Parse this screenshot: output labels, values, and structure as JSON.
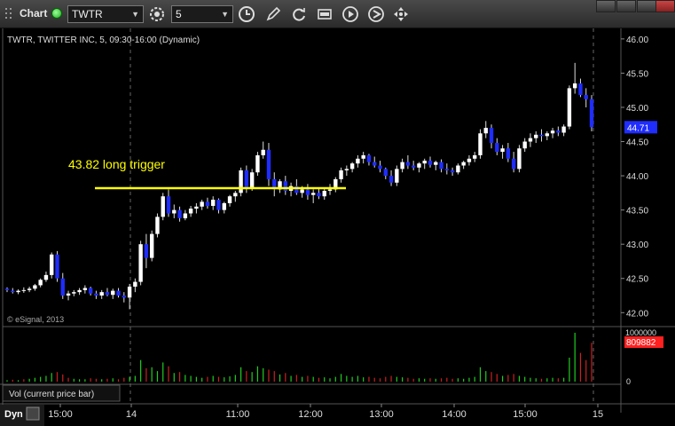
{
  "toolbar": {
    "title": "Chart",
    "symbol": "TWTR",
    "interval": "5",
    "icons": [
      "grip-icon",
      "link-status-icon",
      "settings-gear-icon",
      "clock-icon",
      "pencil-draw-icon",
      "refresh-icon",
      "goto-date-icon",
      "replay-icon",
      "pan-icon"
    ]
  },
  "chart": {
    "header": "TWTR, TWITTER INC, 5, 09:30-16:00 (Dynamic)",
    "copyright": "© eSignal, 2013",
    "annotation": "43.82 long trigger",
    "current_price": "44.71",
    "volume_label": "Vol (current price bar)",
    "volume_current": "809882",
    "volume_top_tick": "1000000",
    "volume_zero_tick": "0",
    "dyn_label": "Dyn",
    "colors": {
      "up": "#ffffff",
      "down": "#1f2dff",
      "annotation": "#ffff00",
      "price_tag": "#1f2dff",
      "volume_tag": "#ff2020",
      "vol_up": "#22cc22",
      "vol_down": "#cc2020"
    }
  },
  "chart_data": {
    "type": "candlestick",
    "y_axis": {
      "ticks": [
        "46.00",
        "45.50",
        "45.00",
        "44.50",
        "44.00",
        "43.50",
        "43.00",
        "42.50",
        "42.00"
      ],
      "range": [
        41.9,
        46.05
      ]
    },
    "x_axis": {
      "ticks": [
        "15:00",
        "14",
        "11:00",
        "12:00",
        "13:00",
        "14:00",
        "15:00",
        "15"
      ]
    },
    "trigger_level": 43.82,
    "candles": [
      [
        42.35,
        42.37,
        42.3,
        42.33
      ],
      [
        42.32,
        42.36,
        42.28,
        42.3
      ],
      [
        42.3,
        42.34,
        42.27,
        42.32
      ],
      [
        42.32,
        42.37,
        42.29,
        42.33
      ],
      [
        42.33,
        42.38,
        42.3,
        42.35
      ],
      [
        42.35,
        42.42,
        42.32,
        42.4
      ],
      [
        42.4,
        42.5,
        42.37,
        42.48
      ],
      [
        42.48,
        42.6,
        42.45,
        42.55
      ],
      [
        42.55,
        42.88,
        42.5,
        42.85
      ],
      [
        42.85,
        42.9,
        42.45,
        42.5
      ],
      [
        42.5,
        42.58,
        42.2,
        42.25
      ],
      [
        42.25,
        42.32,
        42.18,
        42.28
      ],
      [
        42.28,
        42.33,
        42.24,
        42.3
      ],
      [
        42.3,
        42.36,
        42.26,
        42.33
      ],
      [
        42.33,
        42.4,
        42.28,
        42.36
      ],
      [
        42.36,
        42.38,
        42.25,
        42.28
      ],
      [
        42.28,
        42.32,
        42.2,
        42.25
      ],
      [
        42.25,
        42.33,
        42.2,
        42.3
      ],
      [
        42.3,
        42.36,
        42.24,
        42.26
      ],
      [
        42.26,
        42.35,
        42.2,
        42.32
      ],
      [
        42.32,
        42.36,
        42.22,
        42.25
      ],
      [
        42.25,
        42.3,
        42.15,
        42.22
      ],
      [
        42.22,
        42.42,
        42.05,
        42.38
      ],
      [
        42.38,
        42.5,
        42.3,
        42.45
      ],
      [
        42.45,
        43.05,
        42.4,
        43.0
      ],
      [
        43.0,
        43.15,
        42.65,
        42.8
      ],
      [
        42.8,
        43.2,
        42.75,
        43.15
      ],
      [
        43.15,
        43.45,
        43.1,
        43.4
      ],
      [
        43.4,
        43.75,
        43.35,
        43.7
      ],
      [
        43.7,
        43.8,
        43.4,
        43.45
      ],
      [
        43.45,
        43.58,
        43.38,
        43.5
      ],
      [
        43.5,
        43.55,
        43.33,
        43.38
      ],
      [
        43.38,
        43.5,
        43.35,
        43.45
      ],
      [
        43.45,
        43.56,
        43.4,
        43.52
      ],
      [
        43.52,
        43.6,
        43.45,
        43.55
      ],
      [
        43.55,
        43.65,
        43.5,
        43.62
      ],
      [
        43.62,
        43.68,
        43.52,
        43.56
      ],
      [
        43.56,
        43.7,
        43.5,
        43.65
      ],
      [
        43.65,
        43.67,
        43.45,
        43.5
      ],
      [
        43.5,
        43.62,
        43.45,
        43.6
      ],
      [
        43.6,
        43.72,
        43.55,
        43.7
      ],
      [
        43.7,
        43.78,
        43.62,
        43.75
      ],
      [
        43.75,
        44.12,
        43.7,
        44.08
      ],
      [
        44.08,
        44.15,
        43.75,
        43.82
      ],
      [
        43.82,
        44.1,
        43.78,
        44.05
      ],
      [
        44.05,
        44.35,
        44.0,
        44.3
      ],
      [
        44.3,
        44.5,
        44.25,
        44.38
      ],
      [
        44.38,
        44.48,
        43.85,
        43.95
      ],
      [
        43.95,
        44.05,
        43.7,
        43.8
      ],
      [
        43.8,
        43.95,
        43.75,
        43.92
      ],
      [
        43.92,
        44.0,
        43.72,
        43.78
      ],
      [
        43.78,
        43.9,
        43.7,
        43.85
      ],
      [
        43.85,
        43.95,
        43.72,
        43.75
      ],
      [
        43.75,
        43.85,
        43.68,
        43.8
      ],
      [
        43.8,
        43.88,
        43.65,
        43.72
      ],
      [
        43.72,
        43.8,
        43.6,
        43.75
      ],
      [
        43.75,
        43.82,
        43.66,
        43.7
      ],
      [
        43.7,
        43.82,
        43.65,
        43.78
      ],
      [
        43.78,
        43.88,
        43.72,
        43.8
      ],
      [
        43.8,
        43.98,
        43.76,
        43.95
      ],
      [
        43.95,
        44.12,
        43.9,
        44.08
      ],
      [
        44.08,
        44.15,
        44.0,
        44.1
      ],
      [
        44.1,
        44.2,
        44.05,
        44.18
      ],
      [
        44.18,
        44.3,
        44.12,
        44.25
      ],
      [
        44.25,
        44.35,
        44.18,
        44.3
      ],
      [
        44.3,
        44.32,
        44.15,
        44.2
      ],
      [
        44.2,
        44.28,
        44.12,
        44.15
      ],
      [
        44.15,
        44.22,
        44.05,
        44.1
      ],
      [
        44.1,
        44.12,
        43.95,
        44.0
      ],
      [
        44.0,
        44.08,
        43.85,
        43.9
      ],
      [
        43.9,
        44.15,
        43.85,
        44.1
      ],
      [
        44.1,
        44.25,
        44.05,
        44.2
      ],
      [
        44.2,
        44.3,
        44.1,
        44.15
      ],
      [
        44.15,
        44.22,
        44.08,
        44.12
      ],
      [
        44.12,
        44.2,
        44.05,
        44.18
      ],
      [
        44.18,
        44.25,
        44.1,
        44.22
      ],
      [
        44.22,
        44.28,
        44.12,
        44.16
      ],
      [
        44.16,
        44.22,
        44.08,
        44.2
      ],
      [
        44.2,
        44.24,
        44.05,
        44.1
      ],
      [
        44.1,
        44.18,
        44.02,
        44.08
      ],
      [
        44.08,
        44.12,
        44.0,
        44.05
      ],
      [
        44.05,
        44.18,
        44.02,
        44.15
      ],
      [
        44.15,
        44.22,
        44.1,
        44.2
      ],
      [
        44.2,
        44.3,
        44.15,
        44.25
      ],
      [
        44.25,
        44.35,
        44.2,
        44.3
      ],
      [
        44.3,
        44.68,
        44.25,
        44.62
      ],
      [
        44.62,
        44.8,
        44.55,
        44.7
      ],
      [
        44.7,
        44.75,
        44.4,
        44.48
      ],
      [
        44.48,
        44.55,
        44.3,
        44.35
      ],
      [
        44.35,
        44.45,
        44.25,
        44.4
      ],
      [
        44.4,
        44.48,
        44.2,
        44.25
      ],
      [
        44.25,
        44.35,
        44.05,
        44.1
      ],
      [
        44.1,
        44.45,
        44.05,
        44.4
      ],
      [
        44.4,
        44.55,
        44.35,
        44.5
      ],
      [
        44.5,
        44.62,
        44.42,
        44.55
      ],
      [
        44.55,
        44.65,
        44.48,
        44.6
      ],
      [
        44.6,
        44.68,
        44.5,
        44.58
      ],
      [
        44.58,
        44.65,
        44.52,
        44.62
      ],
      [
        44.62,
        44.7,
        44.55,
        44.66
      ],
      [
        44.66,
        44.72,
        44.58,
        44.63
      ],
      [
        44.63,
        44.75,
        44.58,
        44.72
      ],
      [
        44.72,
        45.32,
        44.68,
        45.28
      ],
      [
        45.28,
        45.65,
        45.2,
        45.35
      ],
      [
        45.35,
        45.42,
        45.15,
        45.18
      ],
      [
        45.18,
        45.28,
        45.0,
        45.12
      ],
      [
        45.12,
        45.18,
        44.65,
        44.71
      ]
    ],
    "volume": [
      [
        0.03,
        1
      ],
      [
        0.04,
        0
      ],
      [
        0.03,
        1
      ],
      [
        0.05,
        0
      ],
      [
        0.06,
        1
      ],
      [
        0.08,
        1
      ],
      [
        0.1,
        1
      ],
      [
        0.12,
        1
      ],
      [
        0.18,
        1
      ],
      [
        0.2,
        0
      ],
      [
        0.15,
        0
      ],
      [
        0.08,
        0
      ],
      [
        0.06,
        1
      ],
      [
        0.05,
        1
      ],
      [
        0.05,
        1
      ],
      [
        0.07,
        0
      ],
      [
        0.06,
        0
      ],
      [
        0.05,
        1
      ],
      [
        0.06,
        0
      ],
      [
        0.07,
        1
      ],
      [
        0.05,
        0
      ],
      [
        0.08,
        0
      ],
      [
        0.1,
        1
      ],
      [
        0.12,
        1
      ],
      [
        0.45,
        1
      ],
      [
        0.28,
        0
      ],
      [
        0.3,
        1
      ],
      [
        0.22,
        1
      ],
      [
        0.4,
        1
      ],
      [
        0.32,
        0
      ],
      [
        0.18,
        1
      ],
      [
        0.2,
        0
      ],
      [
        0.14,
        1
      ],
      [
        0.12,
        1
      ],
      [
        0.1,
        1
      ],
      [
        0.08,
        1
      ],
      [
        0.1,
        0
      ],
      [
        0.12,
        1
      ],
      [
        0.1,
        0
      ],
      [
        0.09,
        1
      ],
      [
        0.11,
        1
      ],
      [
        0.14,
        1
      ],
      [
        0.3,
        1
      ],
      [
        0.22,
        0
      ],
      [
        0.2,
        1
      ],
      [
        0.32,
        1
      ],
      [
        0.28,
        1
      ],
      [
        0.25,
        0
      ],
      [
        0.22,
        0
      ],
      [
        0.15,
        1
      ],
      [
        0.18,
        0
      ],
      [
        0.12,
        1
      ],
      [
        0.14,
        0
      ],
      [
        0.1,
        1
      ],
      [
        0.12,
        0
      ],
      [
        0.1,
        1
      ],
      [
        0.08,
        0
      ],
      [
        0.09,
        1
      ],
      [
        0.07,
        1
      ],
      [
        0.1,
        1
      ],
      [
        0.16,
        1
      ],
      [
        0.12,
        1
      ],
      [
        0.1,
        1
      ],
      [
        0.12,
        1
      ],
      [
        0.09,
        1
      ],
      [
        0.1,
        0
      ],
      [
        0.08,
        0
      ],
      [
        0.07,
        0
      ],
      [
        0.1,
        0
      ],
      [
        0.12,
        0
      ],
      [
        0.1,
        1
      ],
      [
        0.09,
        1
      ],
      [
        0.08,
        0
      ],
      [
        0.06,
        0
      ],
      [
        0.07,
        1
      ],
      [
        0.06,
        1
      ],
      [
        0.07,
        0
      ],
      [
        0.06,
        1
      ],
      [
        0.07,
        0
      ],
      [
        0.08,
        0
      ],
      [
        0.06,
        0
      ],
      [
        0.07,
        1
      ],
      [
        0.06,
        1
      ],
      [
        0.08,
        1
      ],
      [
        0.1,
        1
      ],
      [
        0.3,
        1
      ],
      [
        0.22,
        1
      ],
      [
        0.2,
        0
      ],
      [
        0.16,
        0
      ],
      [
        0.12,
        1
      ],
      [
        0.14,
        0
      ],
      [
        0.16,
        0
      ],
      [
        0.12,
        1
      ],
      [
        0.1,
        1
      ],
      [
        0.08,
        1
      ],
      [
        0.07,
        1
      ],
      [
        0.06,
        0
      ],
      [
        0.07,
        1
      ],
      [
        0.08,
        1
      ],
      [
        0.07,
        0
      ],
      [
        0.08,
        1
      ],
      [
        0.5,
        1
      ],
      [
        1.02,
        1
      ],
      [
        0.6,
        0
      ],
      [
        0.45,
        0
      ],
      [
        0.81,
        0
      ]
    ]
  }
}
